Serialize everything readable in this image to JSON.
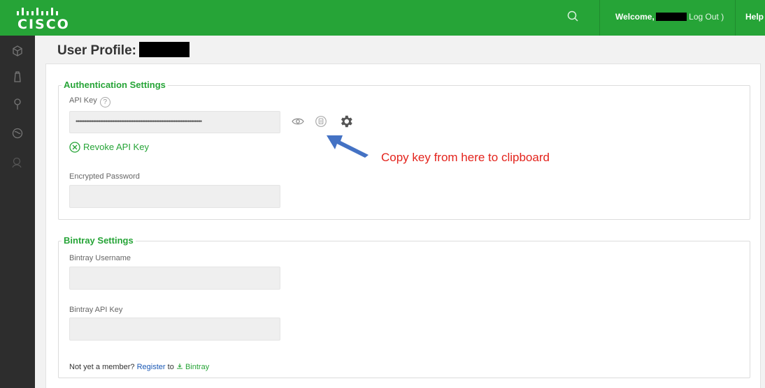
{
  "header": {
    "logo_text": "CISCO",
    "welcome_label": "Welcome,",
    "logout_label": "Log Out )",
    "help_label": "Help"
  },
  "sidebar": {
    "items": [
      {
        "icon": "package-icon"
      },
      {
        "icon": "artifact-icon"
      },
      {
        "icon": "build-icon"
      },
      {
        "icon": "distribution-icon"
      },
      {
        "icon": "admin-icon"
      }
    ]
  },
  "page": {
    "title": "User Profile:"
  },
  "auth_settings": {
    "legend": "Authentication Settings",
    "api_key_label": "API Key",
    "api_key_help": "?",
    "api_key_value": "••••••••••••••••••••••••••••••••••••••••••••••••••••••••••••••••••••••••",
    "revoke_label": "Revoke API Key",
    "encrypted_password_label": "Encrypted Password",
    "encrypted_password_value": ""
  },
  "annotation": {
    "text": "Copy key from here to clipboard"
  },
  "bintray_settings": {
    "legend": "Bintray Settings",
    "username_label": "Bintray Username",
    "username_value": "",
    "api_key_label": "Bintray API Key",
    "api_key_value": "",
    "not_member_text": "Not yet a member?",
    "register_label": "Register",
    "to_text": "to",
    "bintray_label": "Bintray"
  },
  "colors": {
    "brand_green": "#26a437",
    "sidebar_bg": "#2d2d2d",
    "annotation_red": "#e3231c",
    "arrow_blue": "#4472c4",
    "link_blue": "#1a58b5"
  }
}
